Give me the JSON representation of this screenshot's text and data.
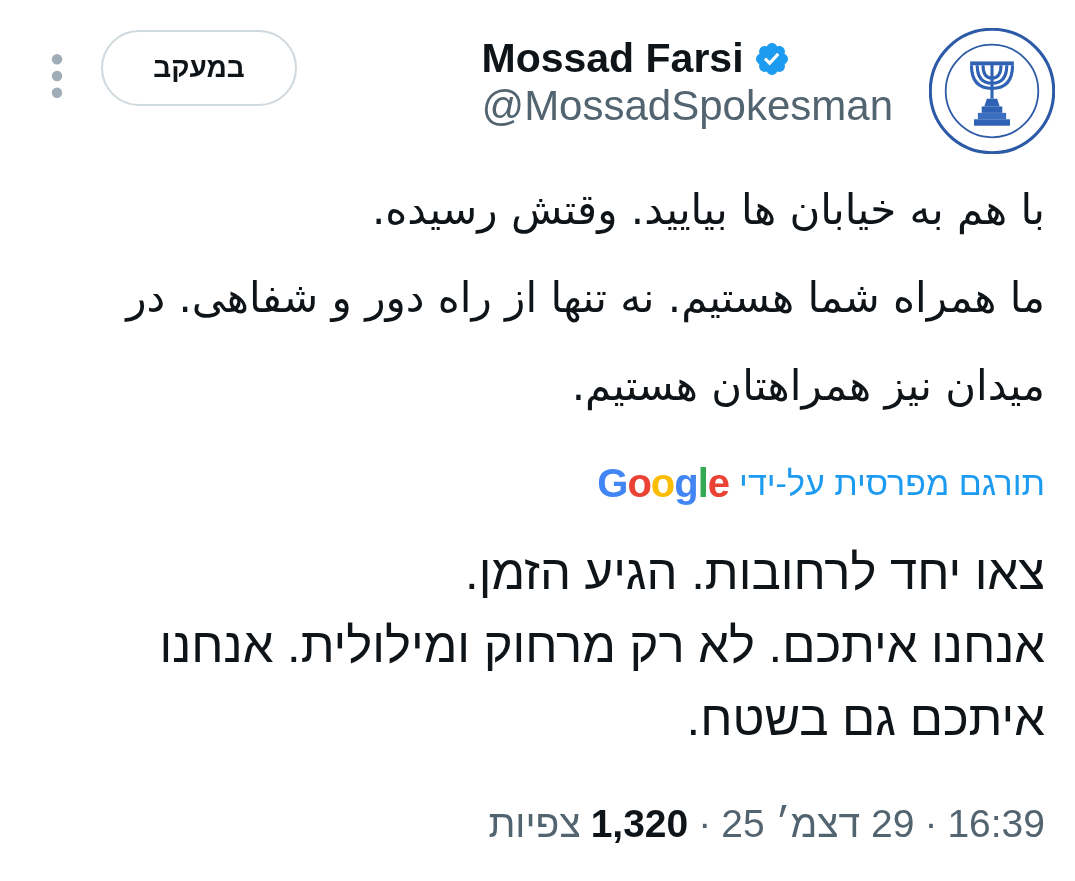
{
  "header": {
    "author": {
      "name": "Mossad Farsi",
      "verified": true,
      "handle": "@MossadSpokesman"
    },
    "follow_button": {
      "label": "במעקב",
      "following": true
    }
  },
  "tweet": {
    "original_text": "با هم به خیابان ها بیایید. وقتش رسیده.\nما همراه شما هستیم. نه تنها از راه دور و شفاهی. در میدان نیز همراهتان هستیم.",
    "translation_note": {
      "label": "תורגם מפרסית על-ידי",
      "provider": "Google"
    },
    "translated_text": "צאו יחד לרחובות. הגיע הזמן.\nאנחנו איתכם. לא רק מרחוק ומילולית. אנחנו איתכם גם בשטח.",
    "meta": [
      {
        "kind": "time",
        "text": "16:39"
      },
      {
        "kind": "separator",
        "text": "·"
      },
      {
        "kind": "date",
        "text": "29 דצמ׳ 25"
      },
      {
        "kind": "separator",
        "text": "·"
      },
      {
        "kind": "count",
        "text": "1,320"
      },
      {
        "kind": "label",
        "text": "צפיות"
      }
    ]
  }
}
